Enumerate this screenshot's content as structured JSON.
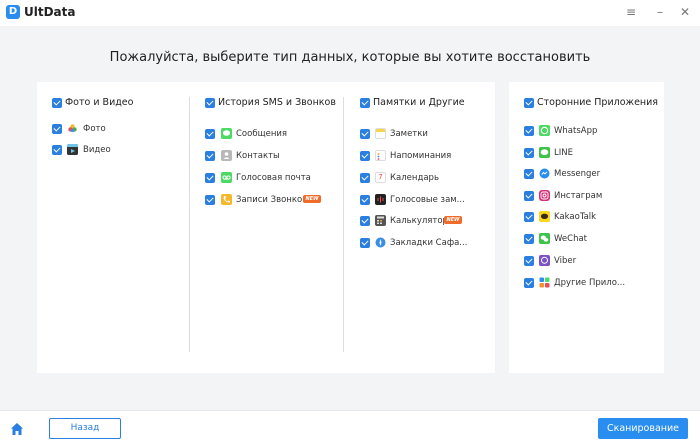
{
  "app": {
    "name": "UltData"
  },
  "window": {
    "menu_icon": "hamburger-icon",
    "minimize_icon": "minimize-icon",
    "close_icon": "close-icon"
  },
  "heading": "Пожалуйста, выберите тип данных, которые вы хотите восстановить",
  "groups": {
    "photos": {
      "title": "Фото и Видео",
      "items": [
        {
          "label": "Фото",
          "icon": "photos-icon"
        },
        {
          "label": "Видео",
          "icon": "video-icon"
        }
      ]
    },
    "sms": {
      "title": "История SMS и Звонков",
      "items": [
        {
          "label": "Сообщения",
          "icon": "messages-icon"
        },
        {
          "label": "Контакты",
          "icon": "contacts-icon"
        },
        {
          "label": "Голосовая почта",
          "icon": "voicemail-icon"
        },
        {
          "label": "Записи Звонков",
          "icon": "call-history-icon",
          "badge": "NEW"
        }
      ]
    },
    "notes": {
      "title": "Памятки и Другие",
      "items": [
        {
          "label": "Заметки",
          "icon": "notes-icon"
        },
        {
          "label": "Напоминания",
          "icon": "reminders-icon"
        },
        {
          "label": "Календарь",
          "icon": "calendar-icon"
        },
        {
          "label": "Голосовые зам...",
          "icon": "voice-memos-icon"
        },
        {
          "label": "Калькулятор",
          "icon": "calculator-icon",
          "badge": "NEW"
        },
        {
          "label": "Закладки Сафа...",
          "icon": "safari-icon"
        }
      ]
    },
    "apps": {
      "title": "Сторонние Приложения",
      "items": [
        {
          "label": "WhatsApp",
          "icon": "whatsapp-icon"
        },
        {
          "label": "LINE",
          "icon": "line-icon"
        },
        {
          "label": "Messenger",
          "icon": "messenger-icon"
        },
        {
          "label": "Инстаграм",
          "icon": "instagram-icon"
        },
        {
          "label": "KakaoTalk",
          "icon": "kakaotalk-icon"
        },
        {
          "label": "WeChat",
          "icon": "wechat-icon"
        },
        {
          "label": "Viber",
          "icon": "viber-icon"
        },
        {
          "label": "Другие Прило...",
          "icon": "other-apps-icon"
        }
      ]
    }
  },
  "footer": {
    "back": "Назад",
    "scan": "Сканирование",
    "home_icon": "home-icon"
  },
  "colors": {
    "accent": "#2a8df0",
    "checkbox": "#2a7fe0",
    "badge": "#f06a2a"
  }
}
